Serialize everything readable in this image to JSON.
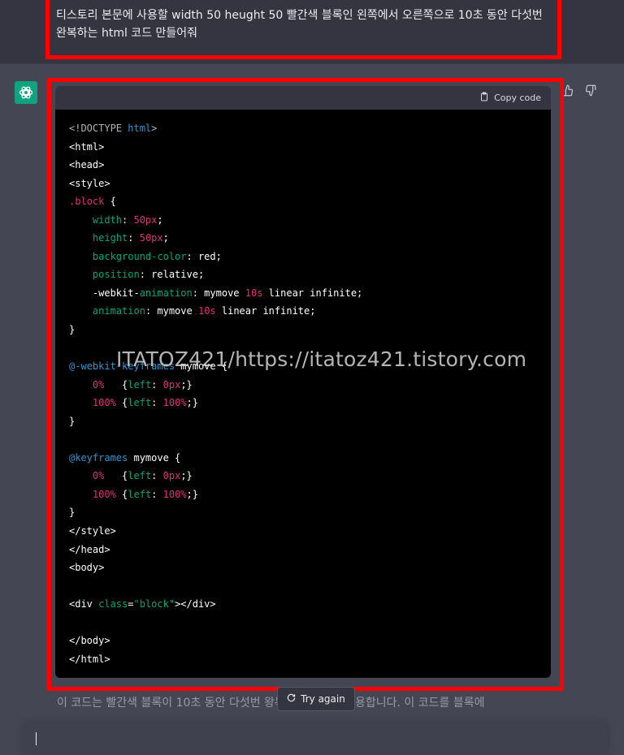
{
  "user_message": "티스토리 본문에 사용할 width 50 heught 50 빨간색 블록인 왼쪽에서 오른쪽으로 10초 동안 다섯번 완복하는 html 코드 만들어줘",
  "code_block": {
    "copy_label": "Copy code",
    "lines": [
      [
        [
          "dim",
          "<!DOCTYPE "
        ],
        [
          "kw",
          "html"
        ],
        [
          "dim",
          ">"
        ]
      ],
      [
        [
          "tag",
          "<html>"
        ]
      ],
      [
        [
          "tag",
          "<head>"
        ]
      ],
      [
        [
          "tag",
          "<style>"
        ]
      ],
      [
        [
          "sel",
          ".block"
        ],
        [
          "tag",
          " {"
        ]
      ],
      [
        [
          "tag",
          "    "
        ],
        [
          "prop",
          "width"
        ],
        [
          "tag",
          ": "
        ],
        [
          "num",
          "50px"
        ],
        [
          "tag",
          ";"
        ]
      ],
      [
        [
          "tag",
          "    "
        ],
        [
          "prop",
          "height"
        ],
        [
          "tag",
          ": "
        ],
        [
          "num",
          "50px"
        ],
        [
          "tag",
          ";"
        ]
      ],
      [
        [
          "tag",
          "    "
        ],
        [
          "prop",
          "background-color"
        ],
        [
          "tag",
          ": red;"
        ]
      ],
      [
        [
          "tag",
          "    "
        ],
        [
          "prop",
          "position"
        ],
        [
          "tag",
          ": relative;"
        ]
      ],
      [
        [
          "tag",
          "    -webkit-"
        ],
        [
          "prop",
          "animation"
        ],
        [
          "tag",
          ": mymove "
        ],
        [
          "num",
          "10s"
        ],
        [
          "tag",
          " linear infinite;"
        ]
      ],
      [
        [
          "tag",
          "    "
        ],
        [
          "prop",
          "animation"
        ],
        [
          "tag",
          ": mymove "
        ],
        [
          "num",
          "10s"
        ],
        [
          "tag",
          " linear infinite;"
        ]
      ],
      [
        [
          "tag",
          "}"
        ]
      ],
      [],
      [
        [
          "at",
          "@-webkit-keyframes"
        ],
        [
          "tag",
          " mymove {"
        ]
      ],
      [
        [
          "tag",
          "    "
        ],
        [
          "num",
          "0%"
        ],
        [
          "tag",
          "   {"
        ],
        [
          "prop",
          "left"
        ],
        [
          "tag",
          ": "
        ],
        [
          "num",
          "0px"
        ],
        [
          "tag",
          ";}"
        ]
      ],
      [
        [
          "tag",
          "    "
        ],
        [
          "num",
          "100%"
        ],
        [
          "tag",
          " {"
        ],
        [
          "prop",
          "left"
        ],
        [
          "tag",
          ": "
        ],
        [
          "num",
          "100%"
        ],
        [
          "tag",
          ";}"
        ]
      ],
      [
        [
          "tag",
          "}"
        ]
      ],
      [],
      [
        [
          "at",
          "@keyframes"
        ],
        [
          "tag",
          " mymove {"
        ]
      ],
      [
        [
          "tag",
          "    "
        ],
        [
          "num",
          "0%"
        ],
        [
          "tag",
          "   {"
        ],
        [
          "prop",
          "left"
        ],
        [
          "tag",
          ": "
        ],
        [
          "num",
          "0px"
        ],
        [
          "tag",
          ";}"
        ]
      ],
      [
        [
          "tag",
          "    "
        ],
        [
          "num",
          "100%"
        ],
        [
          "tag",
          " {"
        ],
        [
          "prop",
          "left"
        ],
        [
          "tag",
          ": "
        ],
        [
          "num",
          "100%"
        ],
        [
          "tag",
          ";}"
        ]
      ],
      [
        [
          "tag",
          "}"
        ]
      ],
      [
        [
          "tag",
          "</style>"
        ]
      ],
      [
        [
          "tag",
          "</head>"
        ]
      ],
      [
        [
          "tag",
          "<body>"
        ]
      ],
      [],
      [
        [
          "tag",
          "<div "
        ],
        [
          "str",
          "class"
        ],
        [
          "tag",
          "="
        ],
        [
          "str",
          "\"block\""
        ],
        [
          "tag",
          "></div>"
        ]
      ],
      [],
      [
        [
          "tag",
          "</body>"
        ]
      ],
      [
        [
          "tag",
          "</html>"
        ]
      ]
    ]
  },
  "watermark": "ITATOZ421/https://itatoz421.tistory.com",
  "answer_text": "이 코드는 빨간색 블록이 10초 동안 다섯번 왕복하는 효과를 적용합니다. 이 코드를 블록에",
  "try_again_label": "Try again",
  "colors": {
    "highlight": "#ff0000",
    "page_bg": "#444654",
    "user_bg": "#343541",
    "avatar_bg": "#10a37f"
  },
  "icons": [
    "openai-logo-icon",
    "thumbs-up-icon",
    "thumbs-down-icon",
    "clipboard-icon",
    "refresh-icon"
  ]
}
